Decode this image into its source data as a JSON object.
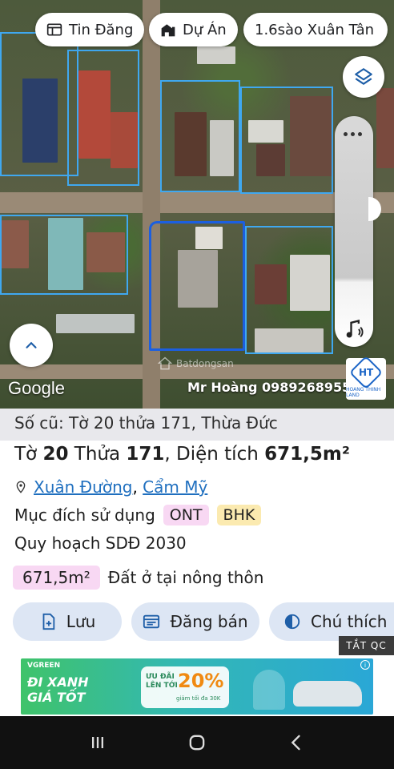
{
  "map": {
    "chips": [
      {
        "label": "Tin Đăng",
        "icon": "listing-icon"
      },
      {
        "label": "Dự Án",
        "icon": "project-icon"
      },
      {
        "label": "1.6sào Xuân Tân",
        "icon": ""
      }
    ],
    "google_label": "Google",
    "watermark_contact": "Mr Hoàng 0989268955",
    "center_watermark": "Batdongsan",
    "logo_letters": "HT",
    "logo_caption": "HOANG THINH LAND",
    "colors": {
      "plot_outline": "#3fa8f0",
      "selected_plot": "#1c5fe0"
    }
  },
  "sheet": {
    "old_reference": "Số cũ: Tờ 20 thửa 171, Thừa Đức",
    "title_prefix": "Tờ",
    "sheet_no": "20",
    "plot_word": "Thửa",
    "plot_no": "171",
    "area_label": ", Diện tích",
    "area_value": "671,5m²",
    "location": {
      "ward": "Xuân Đường",
      "separator": ",",
      "district": "Cẩm Mỹ"
    },
    "usage_label": "Mục đích sử dụng",
    "usage_tags": [
      "ONT",
      "BHK"
    ],
    "plan_label": "Quy hoạch SDĐ 2030",
    "area_tag": "671,5m²",
    "area_desc": "Đất ở tại nông thôn",
    "actions": {
      "save": "Lưu",
      "post_sale": "Đăng bán",
      "legend": "Chú thích"
    },
    "ad_hide": "TẮT QC",
    "ad": {
      "brand": "VGREEN",
      "headline_1": "ĐI XANH",
      "headline_2": "GIÁ TỐT",
      "promo_1": "ƯU ĐÃI",
      "promo_2": "LÊN TỚI",
      "promo_pct": "20%",
      "promo_note": "giảm tối đa 30K"
    }
  },
  "navbar": {
    "icons": [
      "recents-icon",
      "home-icon",
      "back-icon"
    ]
  }
}
